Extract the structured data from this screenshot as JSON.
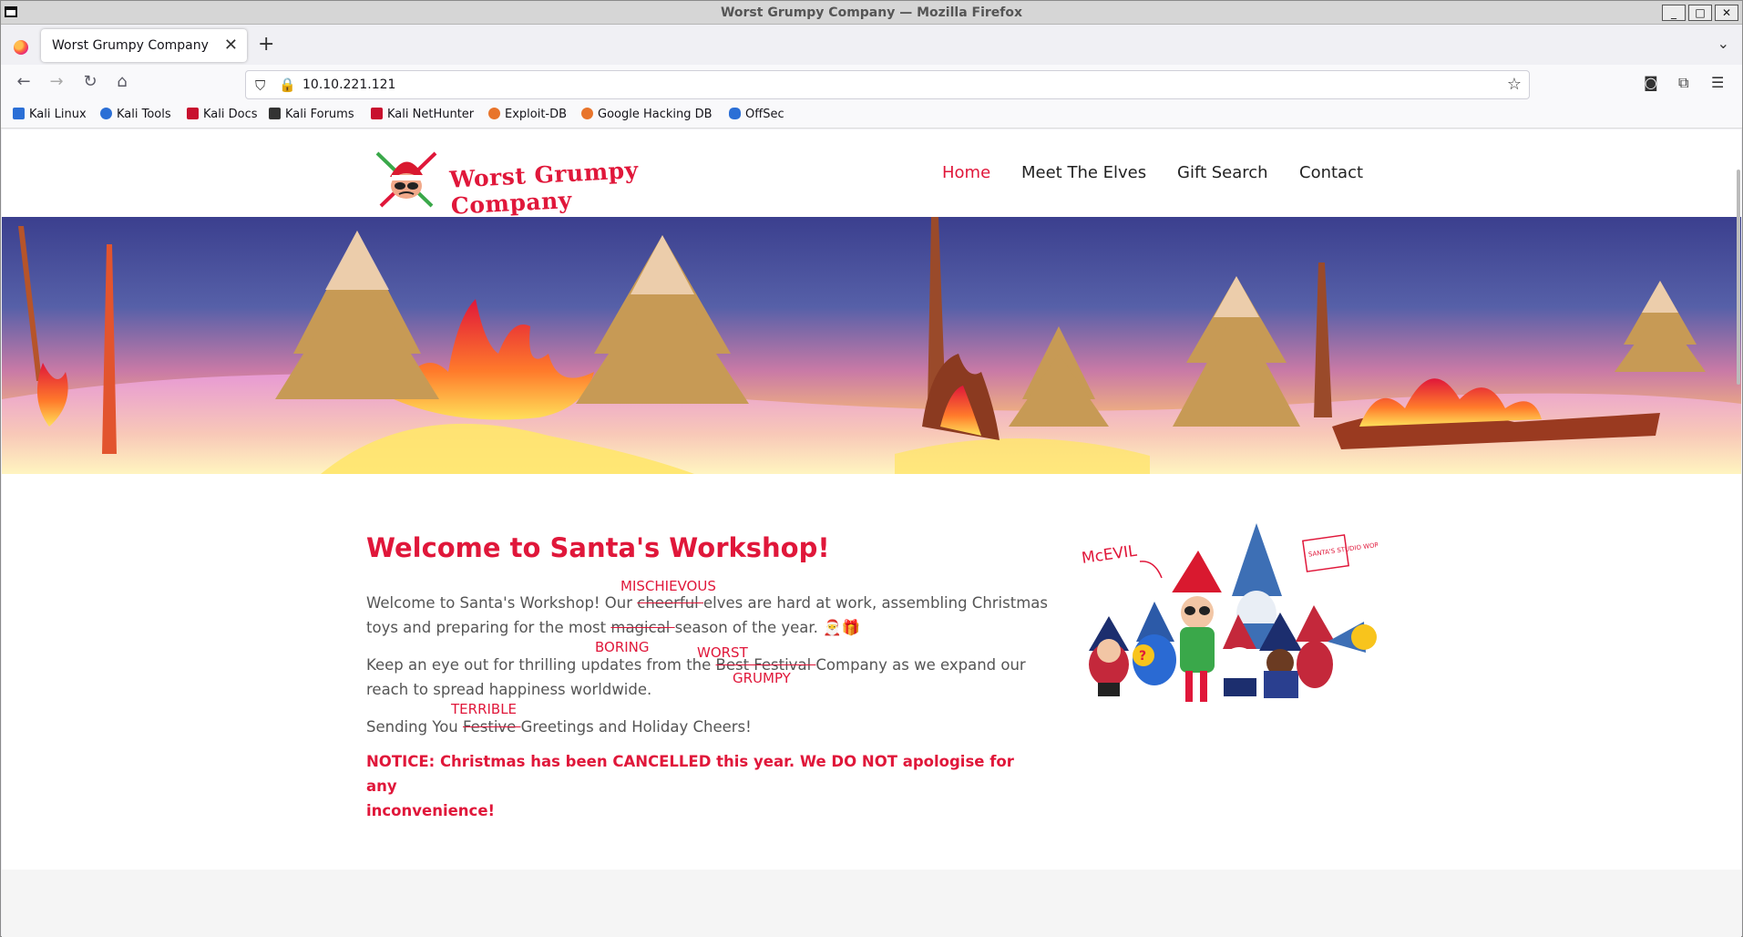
{
  "window": {
    "title": "Worst Grumpy Company — Mozilla Firefox",
    "minimize": "_",
    "maximize": "□",
    "close": "✕"
  },
  "tabs": {
    "active_label": "Worst Grumpy Company",
    "close_glyph": "✕",
    "new_tab_glyph": "+",
    "list_glyph": "⌄"
  },
  "nav": {
    "back": "←",
    "forward": "→",
    "reload": "↻",
    "home": "⌂",
    "url": "10.10.221.121",
    "shield": "⛉",
    "lock": "🔒",
    "star": "☆",
    "pocket": "◙",
    "extensions": "⧉",
    "menu": "☰"
  },
  "bookmarks": [
    {
      "label": "Kali Linux",
      "color": "#2b6fd6"
    },
    {
      "label": "Kali Tools",
      "color": "#2b6fd6"
    },
    {
      "label": "Kali Docs",
      "color": "#c8102e"
    },
    {
      "label": "Kali Forums",
      "color": "#333333"
    },
    {
      "label": "Kali NetHunter",
      "color": "#c8102e"
    },
    {
      "label": "Exploit-DB",
      "color": "#e8742b"
    },
    {
      "label": "Google Hacking DB",
      "color": "#e8742b"
    },
    {
      "label": "OffSec",
      "color": "#2b6fd6"
    }
  ],
  "site": {
    "logo_text": "Worst Grumpy Company",
    "menu": [
      "Home",
      "Meet The Elves",
      "Gift Search",
      "Contact"
    ],
    "accent": "#e0173a"
  },
  "content": {
    "heading": "Welcome to Santa's Workshop!",
    "p1_a": "Welcome to Santa's Workshop! Our ",
    "p1_strike1": "cheerful ",
    "p1_b": "elves are hard at work, assembling Christmas",
    "p1_c": "toys and preparing for the most ",
    "p1_strike2": "magical ",
    "p1_d": "season of the year. ",
    "p1_emoji": "🎅🎁",
    "scribble_mischievous": "MISCHIEVOUS",
    "scribble_boring": "BORING",
    "p2_a": "Keep an eye out for thrilling updates from the ",
    "p2_strike": "Best Festival ",
    "p2_b": "Company as we expand our",
    "p2_c": "reach to spread happiness worldwide.",
    "scribble_worst": "WORST",
    "scribble_grumpy": "GRUMPY",
    "p3_a": "Sending You ",
    "p3_strike": "Festive ",
    "p3_b": "Greetings and Holiday Cheers!",
    "scribble_terrible": "TERRIBLE",
    "notice_1": "NOTICE: Christmas has been CANCELLED this year. We DO NOT apologise for any",
    "notice_2": "inconvenience!",
    "elves_label_left": "McEVIL",
    "elves_sign": "SANTA'S STUDIO WORKSHOP"
  }
}
